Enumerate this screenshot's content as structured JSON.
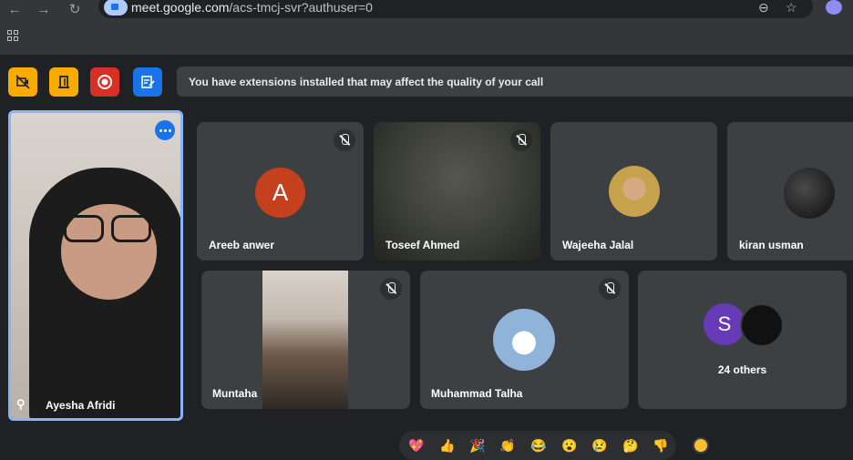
{
  "browser": {
    "url_host": "meet.google.com",
    "url_path": "/acs-tmcj-svr?authuser=0",
    "back_glyph": "←",
    "forward_glyph": "→",
    "reload_glyph": "↻",
    "zoom_glyph": "⊖",
    "star_glyph": "☆"
  },
  "meet_toolbar": {
    "banner_text": "You have extensions installed that may affect the quality of your call",
    "buttons": [
      {
        "icon": "no-camera-icon",
        "color": "#f9ab00"
      },
      {
        "icon": "door-icon",
        "color": "#f9ab00"
      },
      {
        "icon": "record-icon",
        "color": "#d93025"
      },
      {
        "icon": "notes-icon",
        "color": "#1a73e8"
      }
    ]
  },
  "self": {
    "name": "Ayesha Afridi",
    "pin_glyph": "⚲"
  },
  "participants": [
    {
      "name": "Areeb anwer",
      "avatar_letter": "A",
      "avatar_color": "#c5401c",
      "muted": true
    },
    {
      "name": "Toseef Ahmed",
      "muted": true
    },
    {
      "name": "Wajeeha Jalal",
      "muted": false
    },
    {
      "name": "kiran usman",
      "muted": false
    },
    {
      "name": "Muntaha",
      "muted": true
    },
    {
      "name": "Muhammad Talha",
      "muted": true
    }
  ],
  "others": {
    "label": "24 others",
    "avatar_letter": "S",
    "avatar_color": "#673ab7"
  },
  "reactions": [
    "💖",
    "👍",
    "🎉",
    "👏",
    "😂",
    "😮",
    "😢",
    "🤔",
    "👎"
  ],
  "colors": {
    "accent": "#8ab4f8",
    "tile_bg": "#3c4043",
    "page_bg": "#202124"
  }
}
